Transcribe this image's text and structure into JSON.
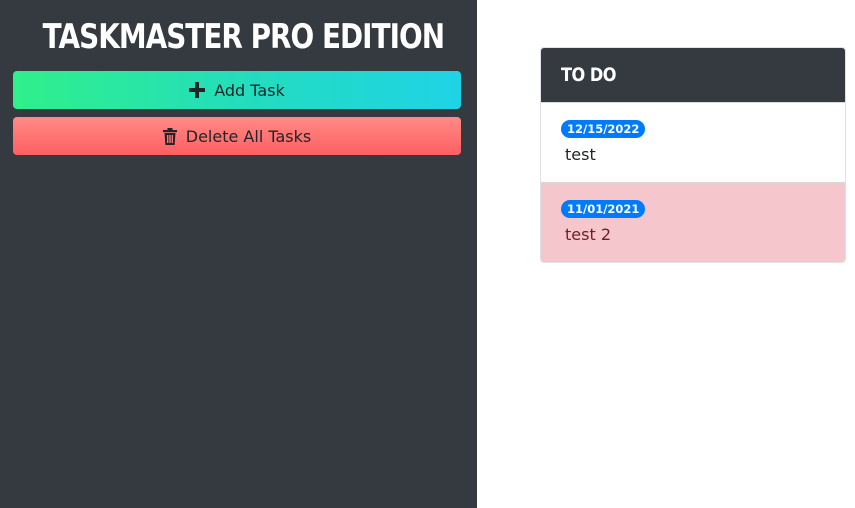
{
  "app": {
    "title": "TASKMASTER PRO EDITION"
  },
  "actions": {
    "add_label": "Add Task",
    "add_icon": "plus-icon",
    "delete_label": "Delete All Tasks",
    "delete_icon": "trash-icon"
  },
  "list": {
    "title": "TO DO",
    "tasks": [
      {
        "date": "12/15/2022",
        "text": "test",
        "status": "normal"
      },
      {
        "date": "11/01/2021",
        "text": "test 2",
        "status": "overdue"
      }
    ]
  },
  "colors": {
    "sidebar": "#343a40",
    "add_start": "#2ff08a",
    "add_end": "#1fd3e6",
    "delete_start": "#ff8a86",
    "delete_end": "#ff5f63",
    "badge": "#007bff",
    "overdue_bg": "#f5c6cb"
  }
}
